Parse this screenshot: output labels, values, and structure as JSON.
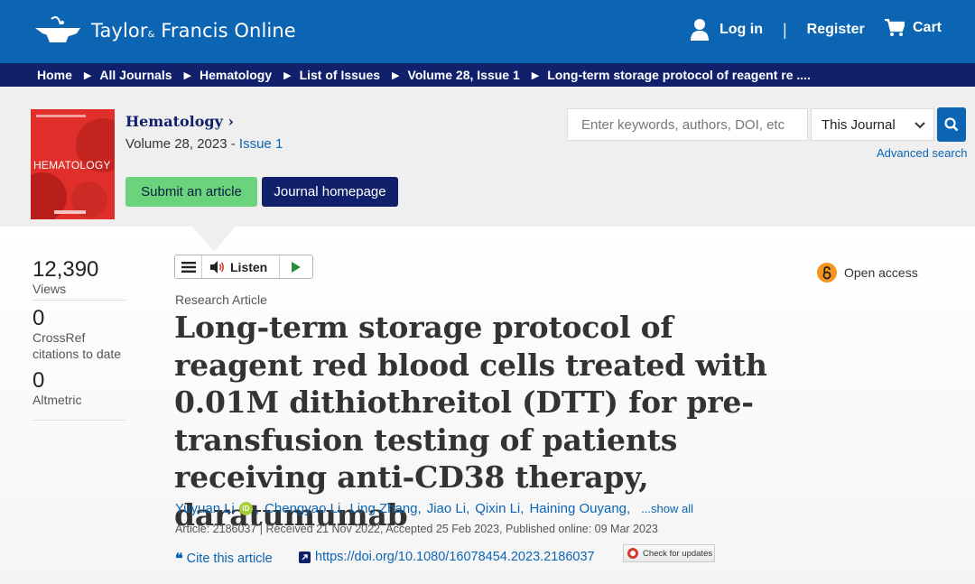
{
  "header": {
    "logo_text": "Taylor",
    "logo_amp": "&",
    "logo_text2": "Francis Online",
    "login": "Log in",
    "separator": "|",
    "register": "Register",
    "cart": "Cart"
  },
  "breadcrumb": [
    "Home",
    "All Journals",
    "Hematology",
    "List of Issues",
    "Volume 28, Issue 1",
    "Long-term storage protocol of reagent re ...."
  ],
  "journal": {
    "name": "Hematology",
    "name_suffix": "›",
    "volume": "Volume 28, 2023 - ",
    "issue": "Issue 1",
    "cover_title": "HEMATOLOGY",
    "submit_label": "Submit an article",
    "homepage_label": "Journal homepage"
  },
  "search": {
    "placeholder": "Enter keywords, authors, DOI, etc",
    "scope": "This Journal",
    "advanced": "Advanced search"
  },
  "metrics": [
    {
      "value": "12,390",
      "label": "Views"
    },
    {
      "value": "0",
      "label": "CrossRef citations to date"
    },
    {
      "value": "0",
      "label": "Altmetric"
    }
  ],
  "listen": {
    "label": "Listen"
  },
  "access": {
    "label": "Open access"
  },
  "article": {
    "type": "Research Article",
    "title": "Long-term storage protocol of reagent red blood cells treated with 0.01M dithiothreitol (DTT) for pre-transfusion testing of patients receiving anti-CD38 therapy, daratumumab",
    "authors": [
      "Yuyuan Li",
      "Chengyao Li",
      "Ling Zhang",
      "Jiao Li",
      "Qixin Li",
      "Haining Ouyang"
    ],
    "show_all": "...show all",
    "meta": "Article: 2186037 | Received 21 Nov 2022, Accepted 25 Feb 2023, Published online: 09 Mar 2023",
    "cite": "Cite this article",
    "doi": "https://doi.org/10.1080/16078454.2023.2186037",
    "check_updates": "Check for updates"
  },
  "colors": {
    "brand_blue": "#0b65b3",
    "navy": "#10206b",
    "submit_green": "#6bd37b",
    "open_access_orange": "#f7941e"
  }
}
